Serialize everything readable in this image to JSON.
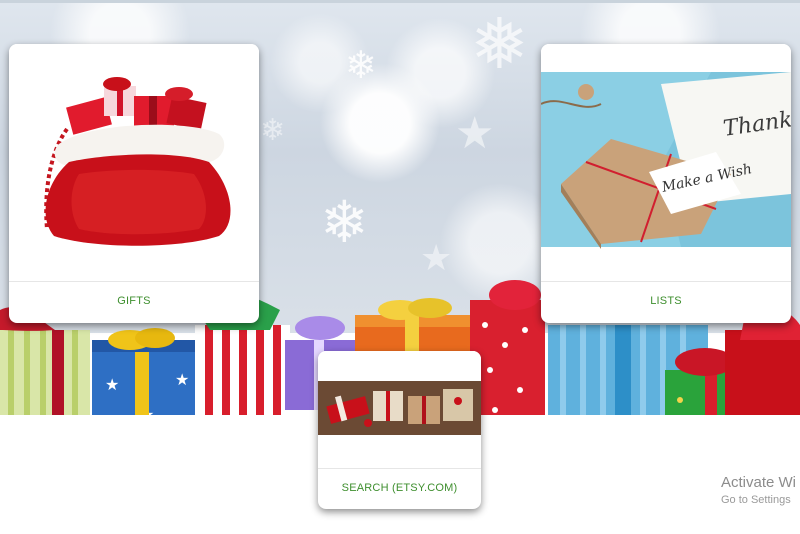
{
  "cards": {
    "gifts": {
      "label": "GIFTS"
    },
    "lists": {
      "label": "LISTS",
      "tag_text": "Make a Wish",
      "note_text": "Thank"
    },
    "search": {
      "label": "SEARCH (ETSY.COM)"
    }
  },
  "windows_watermark": {
    "title": "Activate Wi",
    "subtitle": "Go to Settings"
  },
  "icons": {
    "gifts_image": "santa-sack-icon",
    "lists_image": "wrapped-gift-icon",
    "search_image": "craft-gifts-icon"
  },
  "colors": {
    "label_green": "#3f8f2f",
    "sack_red": "#c8101a",
    "background_blue_gray": "#cdd6e1"
  }
}
